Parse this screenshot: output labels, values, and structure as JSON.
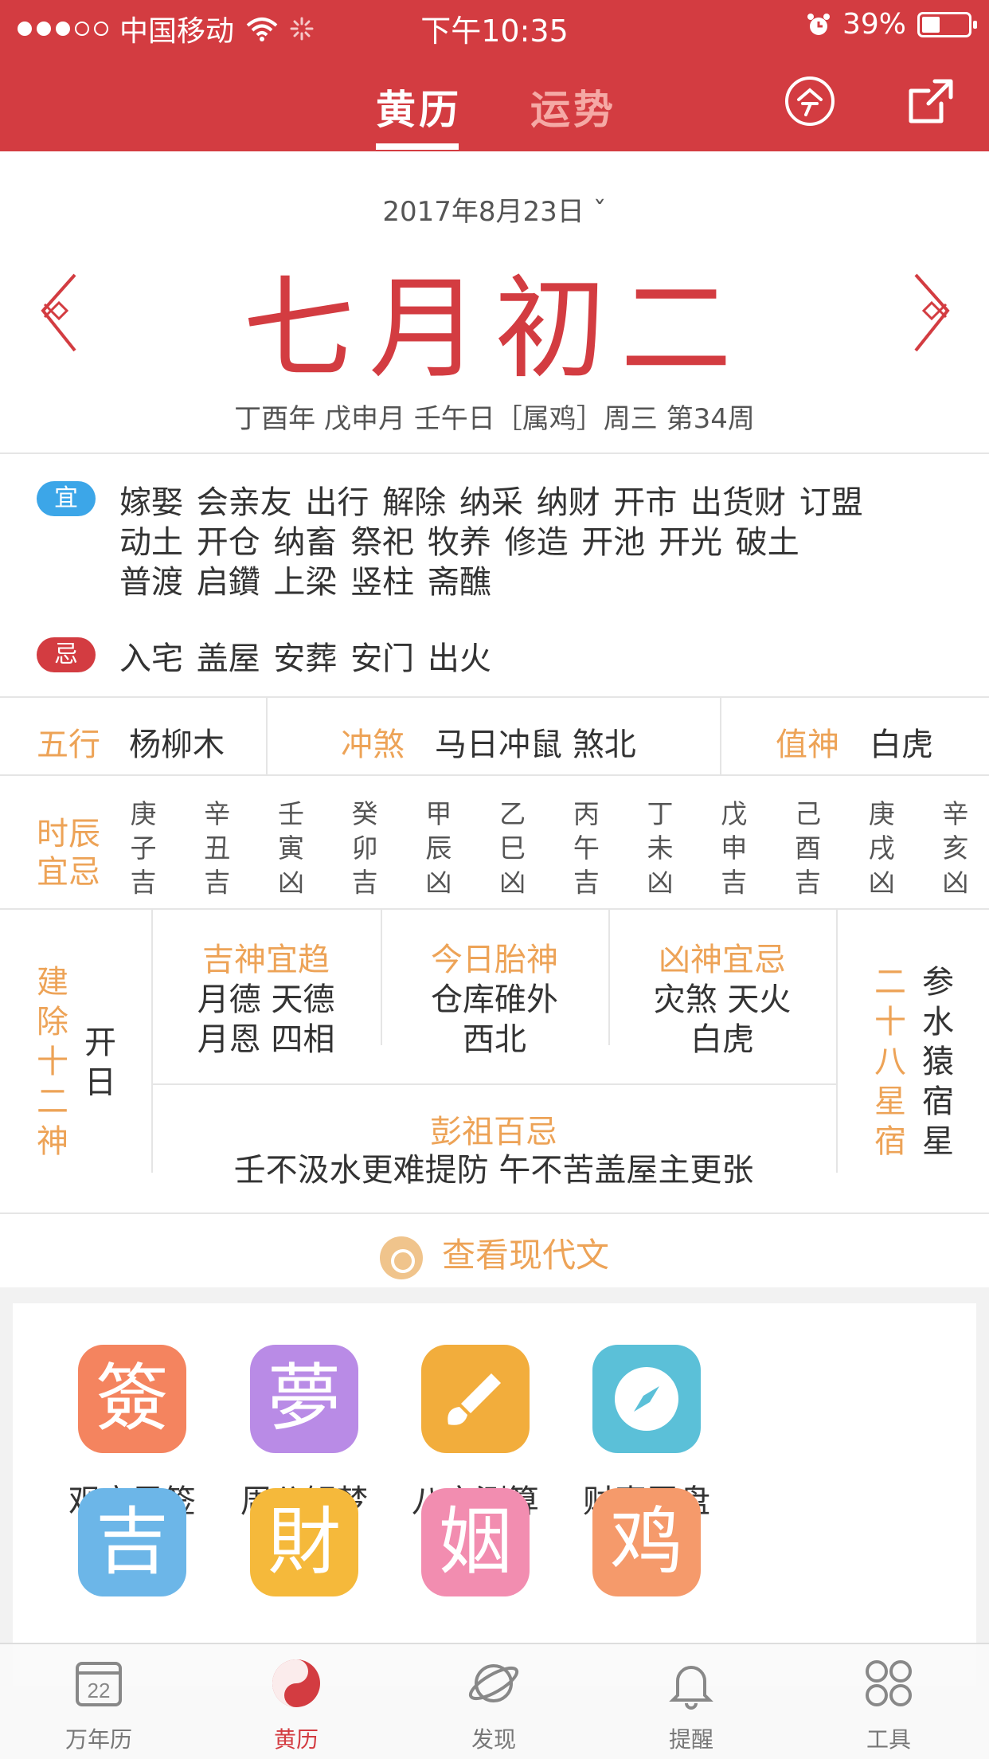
{
  "status_bar": {
    "carrier": "中国移动",
    "time": "下午10:35",
    "battery": "39%"
  },
  "nav": {
    "tab_active": "黄历",
    "tab_other": "运势"
  },
  "date": {
    "selector": "2017年8月23日 ˇ",
    "lunar": "七月初二",
    "ganzhi": "丁酉年 戊申月 壬午日［属鸡］周三  第34周"
  },
  "yi": {
    "badge": "宜",
    "lines": [
      "嫁娶 会亲友 出行 解除 纳采 纳财 开市 出货财 订盟",
      "动土 开仓 纳畜 祭祀 牧养 修造 开池 开光 破土",
      "普渡 启鑽 上梁 竖柱 斋醮"
    ]
  },
  "ji": {
    "badge": "忌",
    "text": "入宅 盖屋 安葬 安门 出火"
  },
  "info": {
    "wuxing_label": "五行",
    "wuxing_value": "杨柳木",
    "chongsha_label": "冲煞",
    "chongsha_value": "马日冲鼠 煞北",
    "zhishen_label": "值神",
    "zhishen_value": "白虎"
  },
  "hours": {
    "label_1": "时辰",
    "label_2": "宜忌",
    "items": [
      {
        "a": "庚",
        "b": "子",
        "c": "吉"
      },
      {
        "a": "辛",
        "b": "丑",
        "c": "吉"
      },
      {
        "a": "壬",
        "b": "寅",
        "c": "凶"
      },
      {
        "a": "癸",
        "b": "卯",
        "c": "吉"
      },
      {
        "a": "甲",
        "b": "辰",
        "c": "凶"
      },
      {
        "a": "乙",
        "b": "巳",
        "c": "凶"
      },
      {
        "a": "丙",
        "b": "午",
        "c": "吉"
      },
      {
        "a": "丁",
        "b": "未",
        "c": "凶"
      },
      {
        "a": "戊",
        "b": "申",
        "c": "吉"
      },
      {
        "a": "己",
        "b": "酉",
        "c": "吉"
      },
      {
        "a": "庚",
        "b": "戌",
        "c": "凶"
      },
      {
        "a": "辛",
        "b": "亥",
        "c": "凶"
      }
    ]
  },
  "gods": {
    "jianchu_label": [
      "建",
      "除",
      "十",
      "二",
      "神"
    ],
    "jianchu_value": [
      "开",
      "日"
    ],
    "jishen_title": "吉神宜趋",
    "jishen_1": "月德 天德",
    "jishen_2": "月恩 四相",
    "taishen_title": "今日胎神",
    "taishen_1": "仓库碓外",
    "taishen_2": "西北",
    "xiongshen_title": "凶神宜忌",
    "xiongshen_1": "灾煞 天火",
    "xiongshen_2": "白虎",
    "xingxiu_label": [
      "二",
      "十",
      "八",
      "星",
      "宿"
    ],
    "xingxiu_value": [
      "参",
      "水",
      "猿",
      "宿",
      "星"
    ],
    "pengzu_title": "彭祖百忌",
    "pengzu_text": "壬不汲水更难提防 午不苦盖屋主更张"
  },
  "modern_text": "查看现代文",
  "apps": [
    {
      "icon_char": "簽",
      "label": "观音灵签",
      "color": "#f4845f"
    },
    {
      "icon_char": "夢",
      "label": "周公解梦",
      "color": "#b98be6"
    },
    {
      "icon_char": "",
      "label": "八字测算",
      "color": "#f2ad3c"
    },
    {
      "icon_char": "",
      "label": "财喜罗盘",
      "color": "#5bc0d8"
    },
    {
      "icon_char": "吉",
      "label": "",
      "color": "#6cb6e8"
    },
    {
      "icon_char": "財",
      "label": "",
      "color": "#f5b93b"
    },
    {
      "icon_char": "姻",
      "label": "",
      "color": "#f28db0"
    },
    {
      "icon_char": "鸡",
      "label": "",
      "color": "#f59a6b"
    }
  ],
  "tabbar": [
    {
      "label": "万年历",
      "badge": "22"
    },
    {
      "label": "黄历"
    },
    {
      "label": "发现"
    },
    {
      "label": "提醒"
    },
    {
      "label": "工具"
    }
  ],
  "colors": {
    "brand": "#d33c41",
    "accent": "#eda357",
    "yi_badge": "#3ca6e8"
  }
}
